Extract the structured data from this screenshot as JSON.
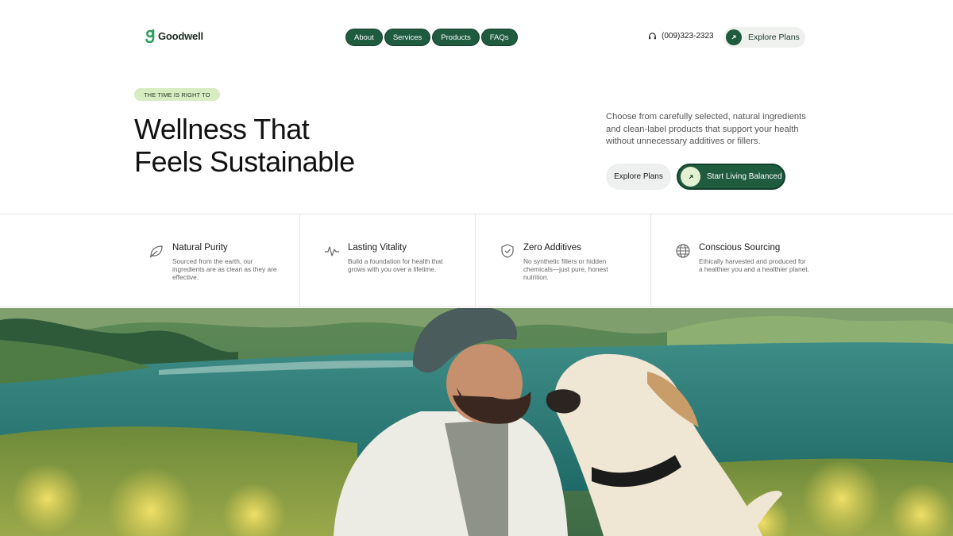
{
  "brand": {
    "name": "Goodwell",
    "color": "#1e5b3f"
  },
  "nav": {
    "items": [
      "About",
      "Services",
      "Products",
      "FAQs"
    ]
  },
  "header": {
    "phone": "(009)323-2323",
    "cta_label": "Explore Plans"
  },
  "hero": {
    "badge": "THE TIME IS RIGHT TO",
    "title_line1": "Wellness That",
    "title_line2": "Feels Sustainable",
    "description": "Choose from carefully selected, natural ingredients and clean-label products that support your health without unnecessary additives or fillers.",
    "secondary_button": "Explore Plans",
    "primary_button": "Start Living Balanced"
  },
  "features": [
    {
      "icon": "leaf-icon",
      "title": "Natural Purity",
      "description": "Sourced from the earth, our ingredients are as clean as they are effective."
    },
    {
      "icon": "pulse-icon",
      "title": "Lasting Vitality",
      "description": "Build a foundation for health that grows with you over a lifetime."
    },
    {
      "icon": "shield-check-icon",
      "title": "Zero Additives",
      "description": "No synthetic fillers or hidden chemicals—just pure, honest nutrition."
    },
    {
      "icon": "globe-icon",
      "title": "Conscious Sourcing",
      "description": "Ethically harvested and produced for a healthier you and a healthier planet."
    }
  ],
  "colors": {
    "accent": "#1e5b3f",
    "badge_bg": "#d8ecc1",
    "light_pill": "#eef0ef"
  }
}
